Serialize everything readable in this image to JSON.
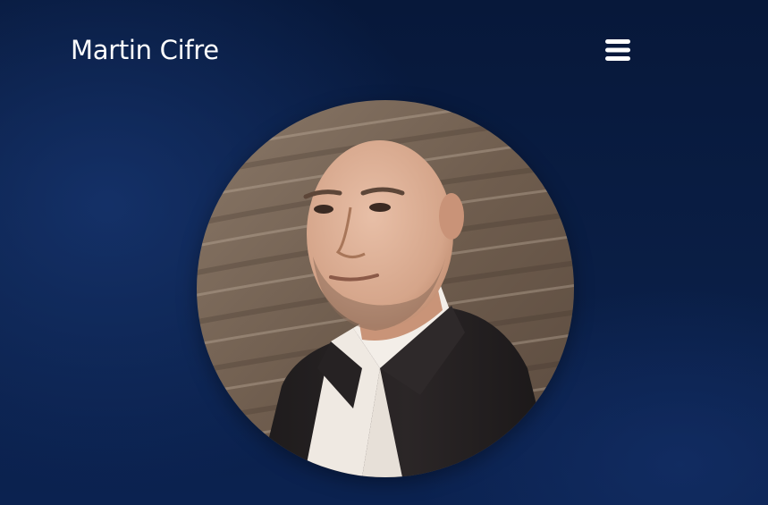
{
  "header": {
    "site_title": "Martin Cifre",
    "menu_icon": "hamburger-menu-icon"
  },
  "hero": {
    "photo_icon": "profile-photo"
  },
  "colors": {
    "background": "#081a3d",
    "text": "#ffffff",
    "accent": "#0f2b63"
  }
}
